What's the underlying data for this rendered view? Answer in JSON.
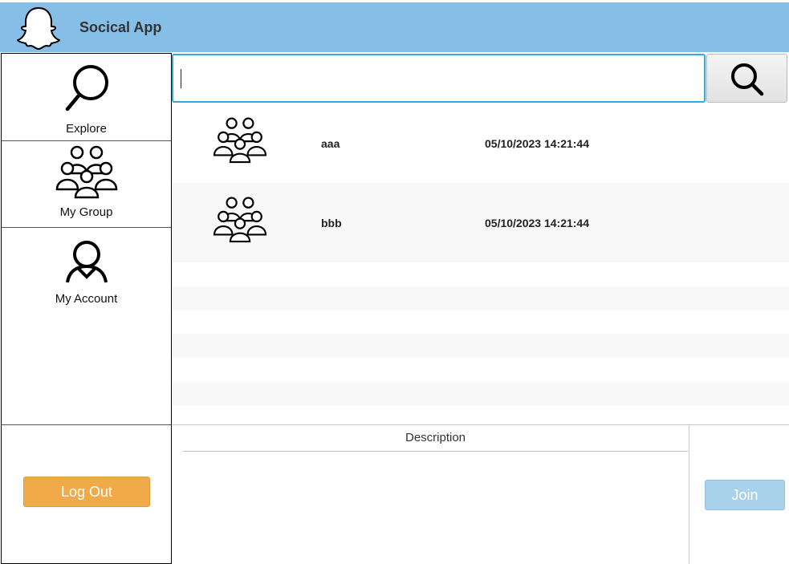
{
  "header": {
    "title": "Socical App",
    "logo_icon": "ghost-icon"
  },
  "sidebar": {
    "items": [
      {
        "label": "Explore",
        "icon": "magnifier-icon"
      },
      {
        "label": "My Group",
        "icon": "group-icon"
      },
      {
        "label": "My Account",
        "icon": "user-icon"
      }
    ],
    "logout_label": "Log Out"
  },
  "search": {
    "value": "",
    "placeholder": "",
    "button_icon": "search-icon"
  },
  "groups": [
    {
      "name": "aaa",
      "time": "05/10/2023 14:21:44",
      "icon": "group-icon"
    },
    {
      "name": "bbb",
      "time": "05/10/2023 14:21:44",
      "icon": "group-icon"
    }
  ],
  "details": {
    "description_header": "Description",
    "description": "",
    "join_label": "Join"
  },
  "colors": {
    "header": "#85bfe7",
    "logout_button": "#f0ab48",
    "join_button_disabled": "#a8d1ec",
    "search_focus_border": "#33aadd"
  }
}
